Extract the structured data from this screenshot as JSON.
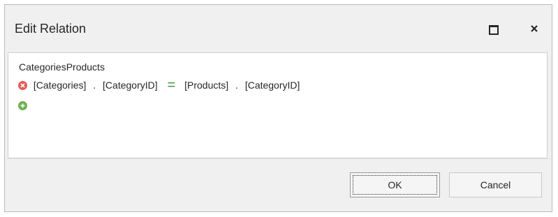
{
  "window": {
    "title": "Edit Relation"
  },
  "relation": {
    "name": "CategoriesProducts",
    "condition": {
      "left_table": "[Categories]",
      "left_column": "[CategoryID]",
      "dot": ".",
      "operator": "=",
      "right_table": "[Products]",
      "right_column": "[CategoryID]"
    }
  },
  "buttons": {
    "ok": "OK",
    "cancel": "Cancel"
  },
  "colors": {
    "remove": "#e25d59",
    "add": "#6db04f",
    "operator": "#3c9a3c"
  }
}
